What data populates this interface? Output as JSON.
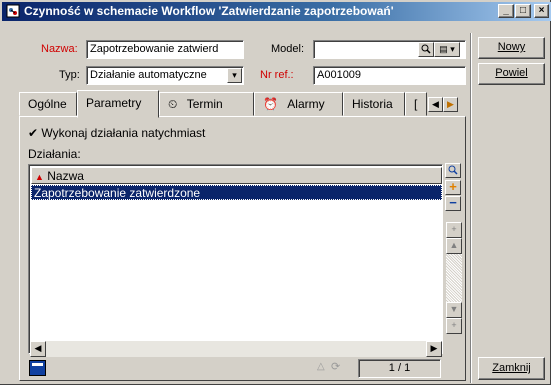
{
  "window": {
    "title": "Czynność w schemacie Workflow 'Zatwierdzanie zapotrzebowań'",
    "controls": [
      "_",
      "□",
      "×"
    ]
  },
  "form": {
    "name_label": "Nazwa:",
    "name_value": "Zapotrzebowanie zatwierd",
    "type_label": "Typ:",
    "type_value": "Działanie automatyczne",
    "model_label": "Model:",
    "model_value": "",
    "ref_label": "Nr ref.:",
    "ref_value": "A001009"
  },
  "buttons": {
    "new": "Nowy",
    "duplicate": "Powiel",
    "close": "Zamknij"
  },
  "tabs": [
    {
      "label": "Ogólne"
    },
    {
      "label": "Parametry"
    },
    {
      "label": "Termin"
    },
    {
      "label": "Alarmy"
    },
    {
      "label": "Historia"
    },
    {
      "label": "["
    }
  ],
  "panel": {
    "checkbox_label": "Wykonaj działania natychmiast",
    "checkbox_checked": true,
    "actions_label": "Działania:",
    "column_header": "Nazwa",
    "rows": [
      {
        "name": "Zapotrzebowanie zatwierdzone",
        "selected": true
      }
    ],
    "record_counter": "1 / 1"
  },
  "colors": {
    "title_start": "#0a246a",
    "selection": "#0a246a",
    "required_label": "#d00000",
    "window_face": "#d4d0c8"
  },
  "icons": {
    "app": "workflow-icon",
    "model_lookup": "magnifier-icon",
    "model_detail": "details-icon",
    "termin_tab": "alarm-clock-icon",
    "alarmy_tab": "alarm-icon",
    "list_search": "magnifier-icon",
    "list_add": "plus-icon",
    "list_remove": "minus-icon",
    "statusbar_left": "monitor-icon"
  }
}
